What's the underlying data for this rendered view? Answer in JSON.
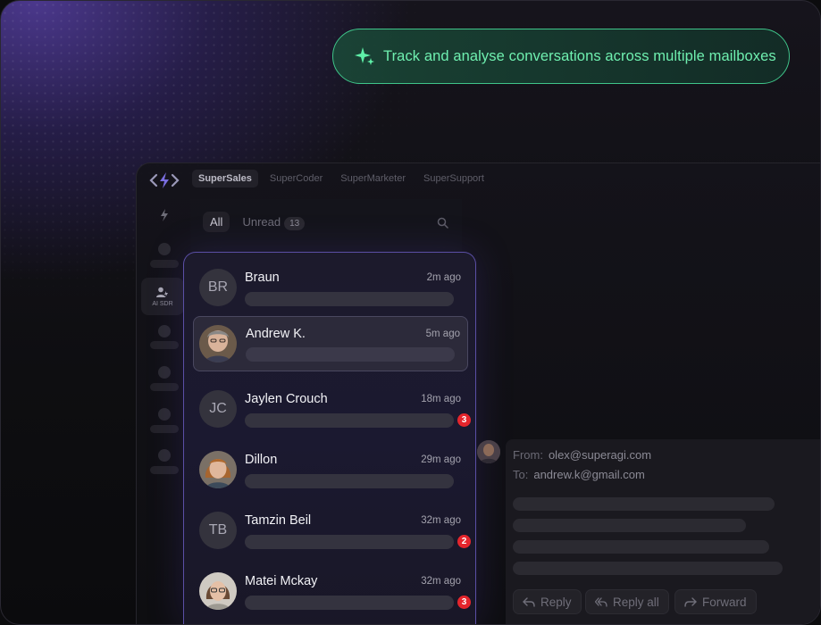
{
  "banner": {
    "text": "Track and analyse conversations across multiple mailboxes",
    "icon": "sparkle-icon",
    "accent": "#3fc58a"
  },
  "topnav": {
    "tabs": [
      "SuperSales",
      "SuperCoder",
      "SuperMarketer",
      "SuperSupport"
    ],
    "active": "SuperSales"
  },
  "rail": {
    "selected_label": "AI SDR"
  },
  "filters": {
    "all": "All",
    "unread": "Unread",
    "unread_count": "13"
  },
  "conversations": [
    {
      "initials": "BR",
      "name": "Braun",
      "time": "2m ago",
      "badge": ""
    },
    {
      "initials": "",
      "name": "Andrew K.",
      "time": "5m ago",
      "badge": "",
      "selected": true
    },
    {
      "initials": "JC",
      "name": "Jaylen Crouch",
      "time": "18m ago",
      "badge": "3"
    },
    {
      "initials": "",
      "name": "Dillon",
      "time": "29m ago",
      "badge": ""
    },
    {
      "initials": "TB",
      "name": "Tamzin Beil",
      "time": "32m ago",
      "badge": "2"
    },
    {
      "initials": "",
      "name": "Matei Mckay",
      "time": "32m ago",
      "badge": "3"
    }
  ],
  "email": {
    "from_label": "From:",
    "from": "olex@superagi.com",
    "to_label": "To:",
    "to": "andrew.k@gmail.com",
    "actions": [
      "Reply",
      "Reply all",
      "Forward"
    ]
  },
  "colors": {
    "list_border": "#5b4fa6",
    "badge": "#e5252c"
  }
}
